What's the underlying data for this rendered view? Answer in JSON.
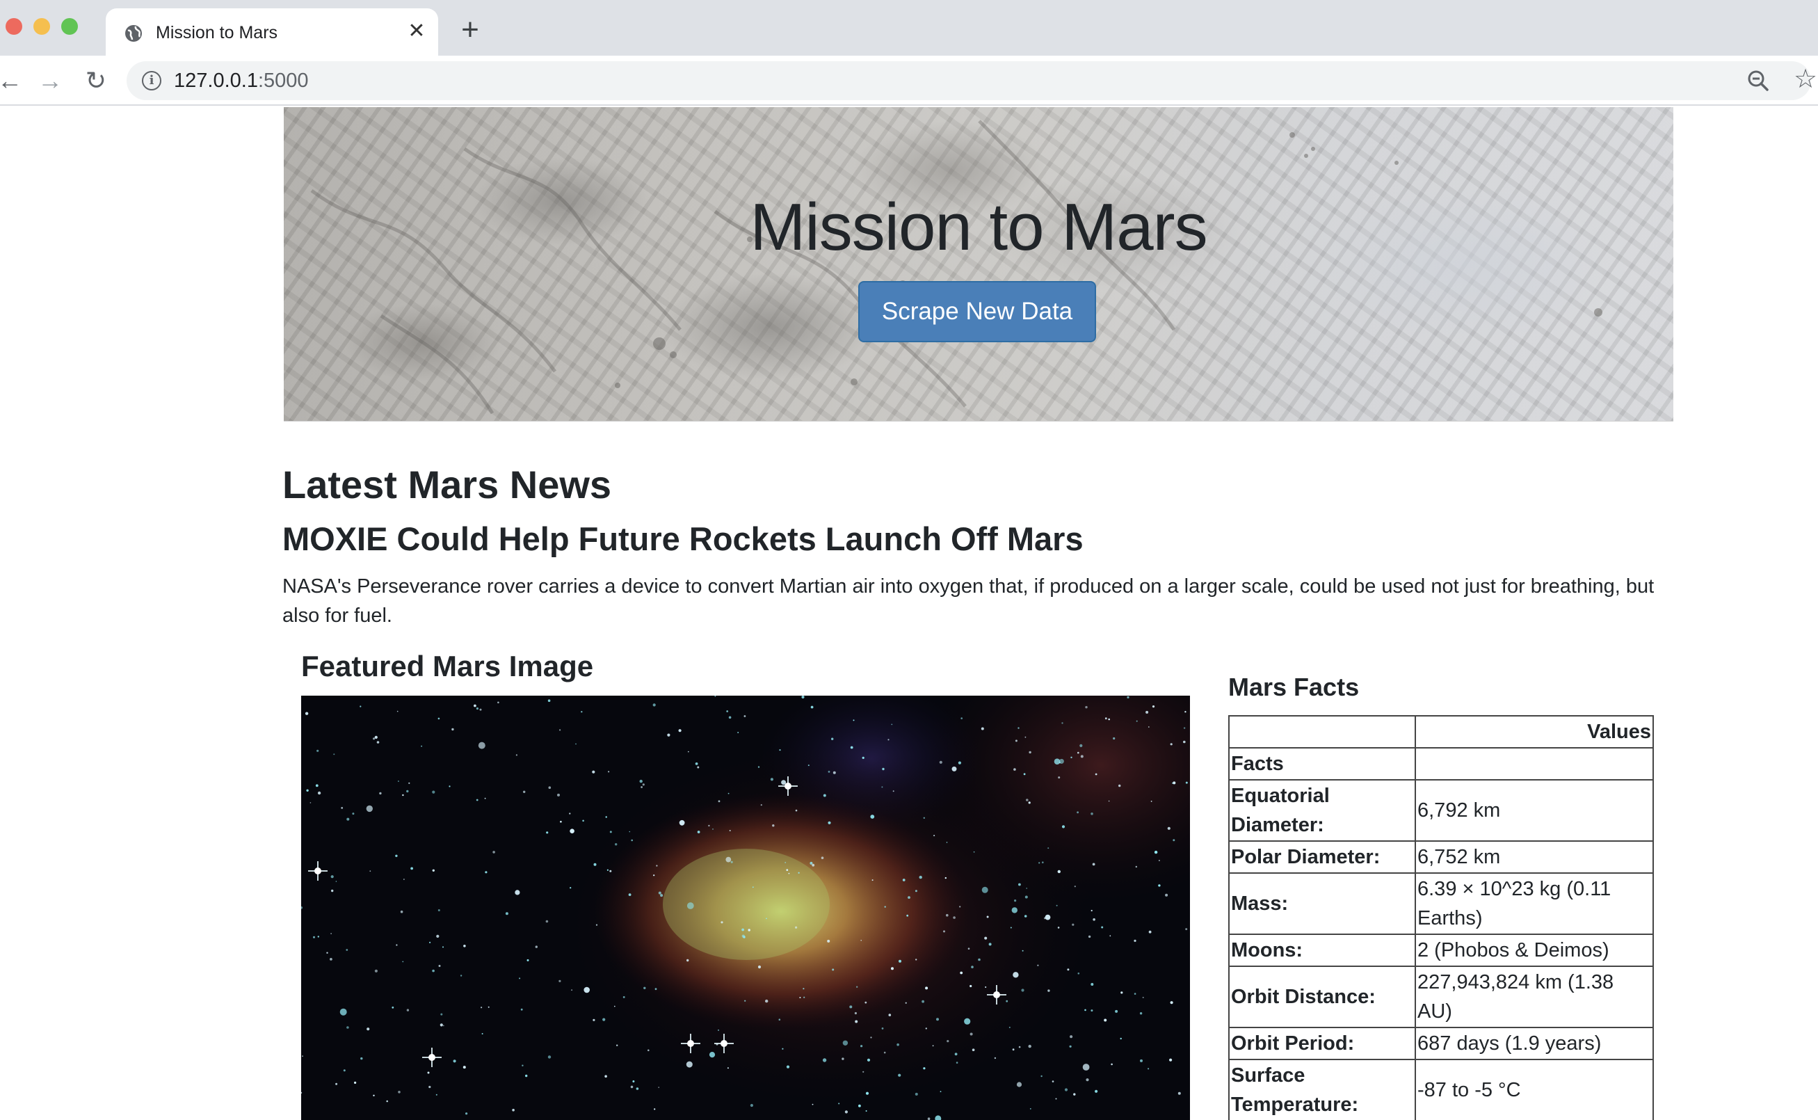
{
  "browser": {
    "tab_title": "Mission to Mars",
    "url_host": "127.0.0.1",
    "url_port": ":5000"
  },
  "header": {
    "title": "Mission to Mars",
    "scrape_button": "Scrape New Data"
  },
  "news": {
    "heading": "Latest Mars News",
    "title": "MOXIE Could Help Future Rockets Launch Off Mars",
    "paragraph": "NASA's Perseverance rover carries a device to convert Martian air into oxygen that, if produced on a larger scale, could be used not just for breathing, but also for fuel."
  },
  "featured": {
    "heading": "Featured Mars Image"
  },
  "facts": {
    "heading": "Mars Facts",
    "column_header": "Values",
    "index_header": "Facts",
    "rows": [
      {
        "label": "Equatorial Diameter:",
        "value": "6,792 km"
      },
      {
        "label": "Polar Diameter:",
        "value": "6,752 km"
      },
      {
        "label": "Mass:",
        "value": "6.39 × 10^23 kg (0.11 Earths)"
      },
      {
        "label": "Moons:",
        "value": "2 (Phobos & Deimos)"
      },
      {
        "label": "Orbit Distance:",
        "value": "227,943,824 km (1.38 AU)"
      },
      {
        "label": "Orbit Period:",
        "value": "687 days (1.9 years)"
      },
      {
        "label": "Surface Temperature:",
        "value": "-87 to -5 °C"
      }
    ]
  }
}
